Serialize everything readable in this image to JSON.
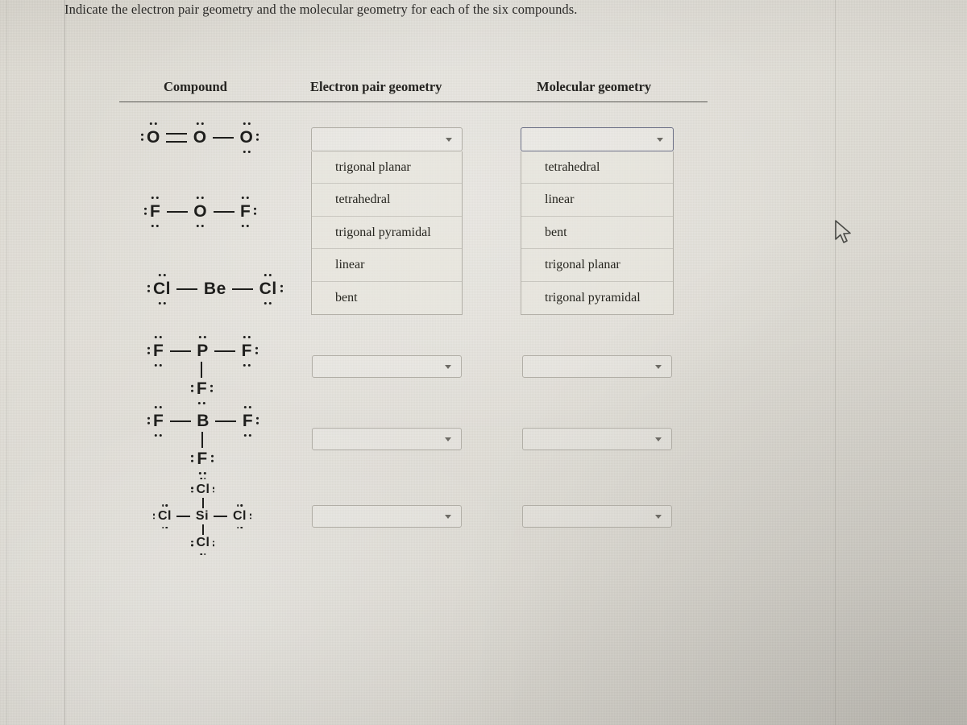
{
  "prompt": {
    "text": "Indicate the electron pair geometry and the molecular geometry for each of the six compounds."
  },
  "table": {
    "headers": {
      "compound": "Compound",
      "electron_pair_geometry": "Electron pair geometry",
      "molecular_geometry": "Molecular geometry"
    }
  },
  "compounds": [
    {
      "id": "ozone",
      "formula_text": ":O=O-O:",
      "atoms": [
        "O",
        "O",
        "O"
      ],
      "bonds": [
        "double",
        "single"
      ]
    },
    {
      "id": "oxygen-difluoride",
      "formula_text": ":F-O-F:",
      "atoms": [
        "F",
        "O",
        "F"
      ],
      "bonds": [
        "single",
        "single"
      ]
    },
    {
      "id": "beryllium-chloride",
      "formula_text": ":Cl-Be-Cl:",
      "atoms": [
        "Cl",
        "Be",
        "Cl"
      ],
      "bonds": [
        "single",
        "single"
      ]
    },
    {
      "id": "phosphorus-trifluoride",
      "formula_text": ":F-P-F: with :F: below",
      "atoms": [
        "F",
        "P",
        "F",
        "F"
      ],
      "bonds": [
        "single",
        "single",
        "single"
      ]
    },
    {
      "id": "boron-trifluoride",
      "formula_text": ":F-B-F: with :F: below",
      "atoms": [
        "F",
        "B",
        "F",
        "F"
      ],
      "bonds": [
        "single",
        "single",
        "single"
      ]
    },
    {
      "id": "silicon-tetrachloride",
      "formula_text": ":Cl-Si-Cl: with :Cl: above and below",
      "atoms": [
        "Cl",
        "Cl",
        "Si",
        "Cl",
        "Cl"
      ],
      "bonds": [
        "single",
        "single",
        "single",
        "single"
      ]
    }
  ],
  "dropdowns": {
    "electron_pair_geometry": {
      "rows": [
        {
          "row": 1,
          "state": "open",
          "value": "",
          "placeholder": ""
        },
        {
          "row": 2,
          "state": "hidden",
          "value": "",
          "placeholder": ""
        },
        {
          "row": 3,
          "state": "hidden",
          "value": "",
          "placeholder": ""
        },
        {
          "row": 4,
          "state": "closed",
          "value": "",
          "placeholder": ""
        },
        {
          "row": 5,
          "state": "closed",
          "value": "",
          "placeholder": ""
        },
        {
          "row": 6,
          "state": "closed",
          "value": "",
          "placeholder": ""
        }
      ],
      "options": [
        "trigonal planar",
        "tetrahedral",
        "trigonal pyramidal",
        "linear",
        "bent"
      ]
    },
    "molecular_geometry": {
      "rows": [
        {
          "row": 1,
          "state": "open",
          "value": "",
          "placeholder": ""
        },
        {
          "row": 2,
          "state": "hidden",
          "value": "",
          "placeholder": ""
        },
        {
          "row": 3,
          "state": "hidden",
          "value": "",
          "placeholder": ""
        },
        {
          "row": 4,
          "state": "closed",
          "value": "",
          "placeholder": ""
        },
        {
          "row": 5,
          "state": "closed",
          "value": "",
          "placeholder": ""
        },
        {
          "row": 6,
          "state": "closed",
          "value": "",
          "placeholder": ""
        }
      ],
      "options": [
        "tetrahedral",
        "linear",
        "bent",
        "trigonal planar",
        "trigonal pyramidal"
      ]
    }
  },
  "cursor": {
    "icon": "mouse-pointer-arrow"
  },
  "colors": {
    "page_background": "#ded9d1",
    "text": "#23221f",
    "rule": "#5d5c58",
    "select_border": "#b1aea6",
    "select_border_focused": "#6b6f86",
    "option_separator": "#a09d96"
  }
}
